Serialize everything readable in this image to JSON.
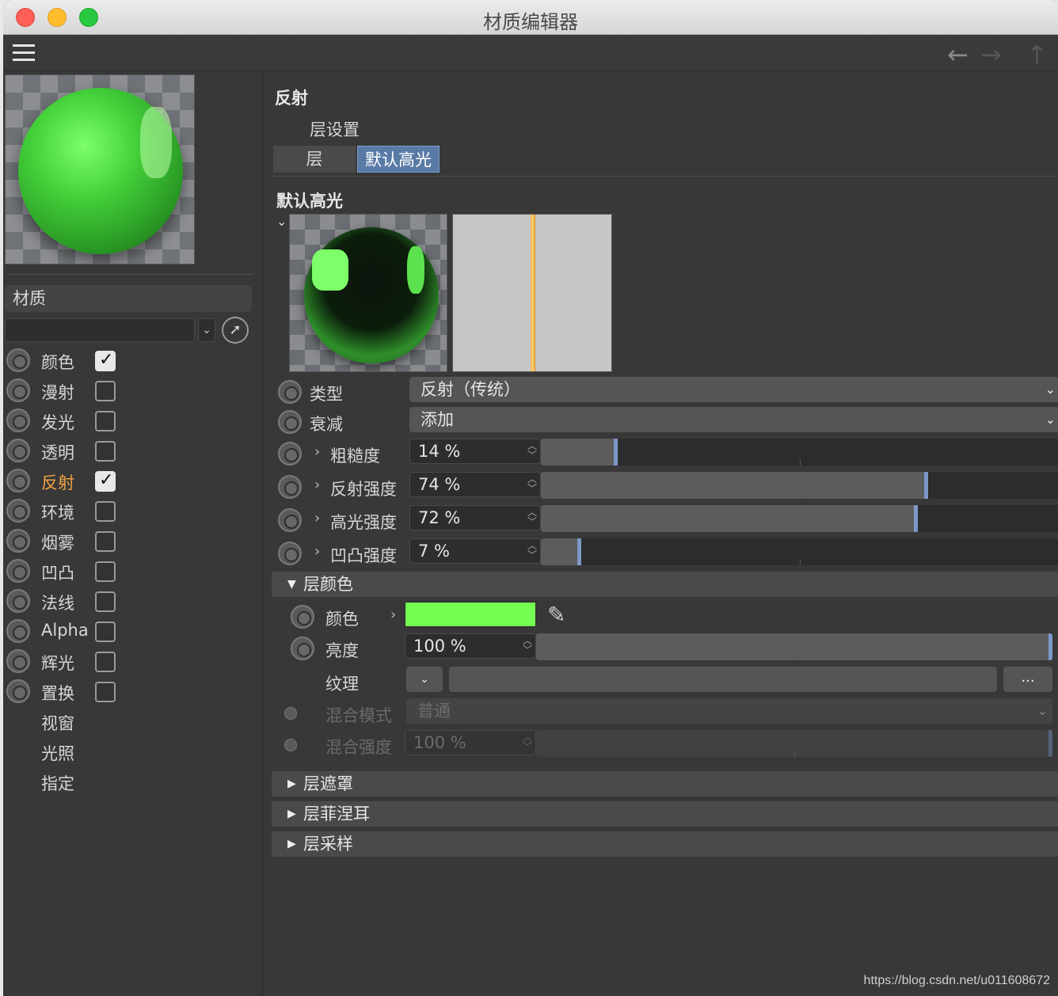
{
  "window": {
    "title": "材质编辑器",
    "nav": {
      "back": "←",
      "forward": "→",
      "up": "↑"
    }
  },
  "sidebar": {
    "material_header": "材质",
    "material_select_value": "",
    "channels": [
      {
        "label": "颜色",
        "checked": true,
        "has_radio": true,
        "has_checkbox": true,
        "active": false
      },
      {
        "label": "漫射",
        "checked": false,
        "has_radio": true,
        "has_checkbox": true,
        "active": false
      },
      {
        "label": "发光",
        "checked": false,
        "has_radio": true,
        "has_checkbox": true,
        "active": false
      },
      {
        "label": "透明",
        "checked": false,
        "has_radio": true,
        "has_checkbox": true,
        "active": false
      },
      {
        "label": "反射",
        "checked": true,
        "has_radio": true,
        "has_checkbox": true,
        "active": true
      },
      {
        "label": "环境",
        "checked": false,
        "has_radio": true,
        "has_checkbox": true,
        "active": false
      },
      {
        "label": "烟雾",
        "checked": false,
        "has_radio": true,
        "has_checkbox": true,
        "active": false
      },
      {
        "label": "凹凸",
        "checked": false,
        "has_radio": true,
        "has_checkbox": true,
        "active": false
      },
      {
        "label": "法线",
        "checked": false,
        "has_radio": true,
        "has_checkbox": true,
        "active": false
      },
      {
        "label": "Alpha",
        "checked": false,
        "has_radio": true,
        "has_checkbox": true,
        "active": false
      },
      {
        "label": "辉光",
        "checked": false,
        "has_radio": true,
        "has_checkbox": true,
        "active": false
      },
      {
        "label": "置换",
        "checked": false,
        "has_radio": true,
        "has_checkbox": true,
        "active": false
      },
      {
        "label": "视窗",
        "checked": false,
        "has_radio": false,
        "has_checkbox": false,
        "active": false
      },
      {
        "label": "光照",
        "checked": false,
        "has_radio": false,
        "has_checkbox": false,
        "active": false
      },
      {
        "label": "指定",
        "checked": false,
        "has_radio": false,
        "has_checkbox": false,
        "active": false
      }
    ],
    "accent_color": "#f0a245"
  },
  "main": {
    "section_title": "反射",
    "layer_settings_label": "层设置",
    "tabs": [
      {
        "label": "层",
        "active": false
      },
      {
        "label": "默认高光",
        "active": true
      }
    ],
    "layer_title": "默认高光",
    "params": {
      "type": {
        "label": "类型",
        "value": "反射（传统）"
      },
      "falloff": {
        "label": "衰减",
        "value": "添加"
      },
      "roughness": {
        "label": "粗糙度",
        "value": "14 %",
        "percent": 14
      },
      "reflection_strength": {
        "label": "反射强度",
        "value": "74 %",
        "percent": 74
      },
      "specular_strength": {
        "label": "高光强度",
        "value": "72 %",
        "percent": 72
      },
      "bump_strength": {
        "label": "凹凸强度",
        "value": "7 %",
        "percent": 7
      }
    },
    "layer_color_group": {
      "title": "层颜色",
      "color_label": "颜色",
      "color_value": "#74ff52",
      "brightness_label": "亮度",
      "brightness_value": "100 %",
      "brightness_percent": 100,
      "texture_label": "纹理",
      "texture_more": "...",
      "blend_mode_label": "混合模式",
      "blend_mode_value": "普通",
      "blend_strength_label": "混合强度",
      "blend_strength_value": "100 %",
      "blend_strength_percent": 100
    },
    "collapsed_groups": [
      "层遮罩",
      "层菲涅耳",
      "层采样"
    ]
  },
  "watermark": "https://blog.csdn.net/u011608672",
  "colors": {
    "active_tab": "#5a7aa6",
    "slider_knob": "#7b98c9",
    "highlight_stripe": "#f3b24a"
  }
}
